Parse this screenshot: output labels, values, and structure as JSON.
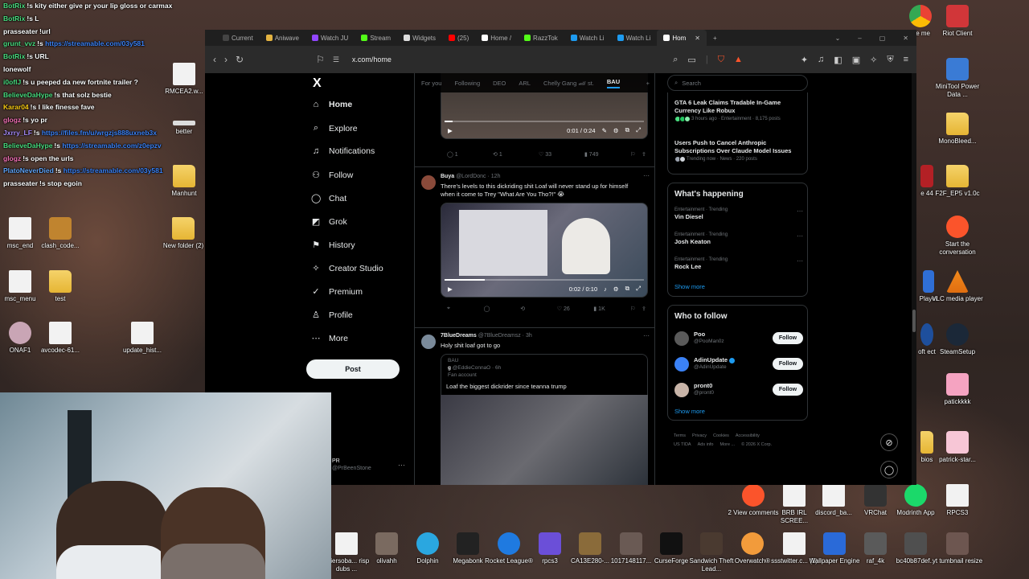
{
  "chat": [
    {
      "user": "BotRix",
      "color": "#4ade80",
      "msg": "!s kity either give pr your lip gloss or carmax",
      "link": ""
    },
    {
      "user": "BotRix",
      "color": "#4ade80",
      "msg": "!s L",
      "link": ""
    },
    {
      "user": "prasseater",
      "color": "#ffffff",
      "msg": "!url",
      "link": ""
    },
    {
      "user": "grunt_vvz",
      "color": "#4ade80",
      "msg": "!s",
      "link": "https://streamable.com/03y581"
    },
    {
      "user": "BotRix",
      "color": "#4ade80",
      "msg": "!s URL",
      "link": ""
    },
    {
      "user": "lonewolf",
      "color": "#ffffff",
      "msg": "",
      "link": ""
    },
    {
      "user": "i0oflJ",
      "color": "#4ade80",
      "msg": "!s u peeped da new fortnite trailer ?",
      "link": ""
    },
    {
      "user": "BelieveDaHype",
      "color": "#4ade80",
      "msg": "!s that solz bestie",
      "link": ""
    },
    {
      "user": "Karar04",
      "color": "#facc15",
      "msg": "!s I like finesse fave",
      "link": ""
    },
    {
      "user": "glogz",
      "color": "#f472b6",
      "msg": "!s yo pr",
      "link": ""
    },
    {
      "user": "Jxrry_LF",
      "color": "#a78bfa",
      "msg": "!s",
      "link": "https://files.fm/u/wrgzjs888uxneb3x"
    },
    {
      "user": "BelieveDaHype",
      "color": "#4ade80",
      "msg": "!s",
      "link": "https://streamable.com/z0epzv"
    },
    {
      "user": "glogz",
      "color": "#f472b6",
      "msg": "!s open the urls",
      "link": ""
    },
    {
      "user": "PlatoNeverDied",
      "color": "#60a5fa",
      "msg": "!s",
      "link": "https://streamable.com/03y581"
    },
    {
      "user": "prasseater",
      "color": "#ffffff",
      "msg": "!s stop egoin",
      "link": ""
    }
  ],
  "desktop_left": [
    {
      "label": "RMCEA2.w...",
      "kind": "file"
    },
    {
      "label": "better",
      "kind": "file"
    },
    {
      "label": "Manhunt",
      "kind": "folder"
    },
    {
      "label": "msc_end",
      "kind": "app"
    },
    {
      "label": "clash_code...",
      "kind": "app"
    },
    {
      "label": "New folder (2)",
      "kind": "folder"
    },
    {
      "label": "msc_menu",
      "kind": "app"
    },
    {
      "label": "test",
      "kind": "folder"
    },
    {
      "label": "ONAF1",
      "kind": "app"
    },
    {
      "label": "avcodec-61...",
      "kind": "file"
    },
    {
      "label": "update_hist...",
      "kind": "file"
    }
  ],
  "desktop_right": [
    {
      "label": "gle me",
      "kind": "app"
    },
    {
      "label": "Riot Client",
      "kind": "app"
    },
    {
      "label": "MiniTool Power Data ...",
      "kind": "app"
    },
    {
      "label": "MonoBleed...",
      "kind": "folder"
    },
    {
      "label": "e 44",
      "kind": "app"
    },
    {
      "label": "F2F_EP5 v1.0c",
      "kind": "folder"
    },
    {
      "label": "Start the conversation",
      "kind": "app"
    },
    {
      "label": "Player",
      "kind": "app"
    },
    {
      "label": "VLC media player",
      "kind": "app"
    },
    {
      "label": "oft ect",
      "kind": "app"
    },
    {
      "label": "SteamSetup",
      "kind": "app"
    },
    {
      "label": "patickkkk",
      "kind": "app"
    },
    {
      "label": "bios",
      "kind": "folder"
    },
    {
      "label": "patrick-star...",
      "kind": "app"
    }
  ],
  "desktop_bottom": [
    {
      "label": "aviersoba... risp dubs ...",
      "kind": "app"
    },
    {
      "label": "olivahh",
      "kind": "app"
    },
    {
      "label": "Dolphin",
      "kind": "app"
    },
    {
      "label": "Megabonk",
      "kind": "app"
    },
    {
      "label": "Rocket League®",
      "kind": "app"
    },
    {
      "label": "rpcs3",
      "kind": "app"
    },
    {
      "label": "CA13E280-...",
      "kind": "app"
    },
    {
      "label": "1017148117...",
      "kind": "app"
    },
    {
      "label": "CurseForge",
      "kind": "app"
    },
    {
      "label": "Sandwich Theft Lead...",
      "kind": "app"
    },
    {
      "label": "Overwatch®",
      "kind": "app"
    },
    {
      "label": "ssstwitter.c... (1)",
      "kind": "file"
    },
    {
      "label": "Wallpaper Engine",
      "kind": "app"
    },
    {
      "label": "raf_4k",
      "kind": "app"
    },
    {
      "label": "bc40b87def...",
      "kind": "app"
    },
    {
      "label": "yt tumbnail resize",
      "kind": "app"
    }
  ],
  "desktop_lower_right": [
    {
      "label": "2 View comments",
      "kind": "app"
    },
    {
      "label": "BRB IRL SCREE...",
      "kind": "file"
    },
    {
      "label": "discord_ba...",
      "kind": "file"
    },
    {
      "label": "VRChat",
      "kind": "app"
    },
    {
      "label": "Modrinth App",
      "kind": "app"
    },
    {
      "label": "RPCS3",
      "kind": "file"
    }
  ],
  "browser": {
    "tabs": [
      {
        "label": "Current",
        "active": false
      },
      {
        "label": "Aniwave",
        "active": false
      },
      {
        "label": "Watch JU",
        "active": false
      },
      {
        "label": "Stream",
        "active": false
      },
      {
        "label": "Widgets",
        "active": false
      },
      {
        "label": "(25)",
        "active": false
      },
      {
        "label": "Home /",
        "active": false
      },
      {
        "label": "RazzTok",
        "active": false
      },
      {
        "label": "Watch Li",
        "active": false
      },
      {
        "label": "Watch Li",
        "active": false
      },
      {
        "label": "Hom",
        "active": true
      }
    ],
    "new_tab": "+",
    "url": "x.com/home"
  },
  "x": {
    "logo": "X",
    "nav": [
      {
        "icon": "⌂",
        "label": "Home",
        "active": true
      },
      {
        "icon": "⌕",
        "label": "Explore",
        "active": false
      },
      {
        "icon": "♫",
        "label": "Notifications",
        "active": false
      },
      {
        "icon": "⚇",
        "label": "Follow",
        "active": false
      },
      {
        "icon": "◯",
        "label": "Chat",
        "active": false
      },
      {
        "icon": "◩",
        "label": "Grok",
        "active": false
      },
      {
        "icon": "⚑",
        "label": "History",
        "active": false
      },
      {
        "icon": "✧",
        "label": "Creator Studio",
        "active": false
      },
      {
        "icon": "✓",
        "label": "Premium",
        "active": false
      },
      {
        "icon": "♙",
        "label": "Profile",
        "active": false
      },
      {
        "icon": "⋯",
        "label": "More",
        "active": false
      }
    ],
    "post_button": "Post",
    "account": {
      "name": "PR",
      "handle": "@PrBeenStone",
      "more": "···"
    },
    "feed_tabs": [
      "For you",
      "Following",
      "DEO",
      "ARL",
      "Chelly Gang 🏎 st.",
      "BAU"
    ],
    "feed_active_tab": "BAU",
    "feed_plus": "+",
    "top_video": {
      "time": "0:01 / 0:24",
      "progress": 0.04
    },
    "top_actions": {
      "replies": "1",
      "reposts": "1",
      "likes": "33",
      "views": "749"
    },
    "tweet1": {
      "name": "Buya",
      "handle": "@LordDonc",
      "time": "12h",
      "text": "There's levels to this dickriding shit Loaf will never stand up for himself when it come to Trey \"What Are You Tho?!\" 😭",
      "video_time": "0:02 / 0:10",
      "progress": 0.2,
      "actions": {
        "replies": "",
        "reposts": "",
        "likes": "26",
        "views": "1K"
      }
    },
    "tweet2": {
      "name": "7BlueDreams",
      "handle": "@7BlueDreamsz",
      "time": "3h",
      "text": "Holy shit loaf got to go",
      "quote": {
        "context": "BAU",
        "name": "g",
        "handle": "@EddieConnaO",
        "time": "6h",
        "badge": "Fan account",
        "text": "Loaf the biggest dickrider since teanna trump"
      }
    },
    "search_placeholder": "Search",
    "news": [
      {
        "title": "GTA 6 Leak Claims Tradable In-Game Currency Like Robux",
        "meta": "3 hours ago · Entertainment · 8,175 posts"
      },
      {
        "title": "Users Push to Cancel Anthropic Subscriptions Over Claude Model Issues",
        "meta": "Trending now · News · 220 posts"
      }
    ],
    "whats_happening_title": "What's happening",
    "trends": [
      {
        "meta": "Entertainment · Trending",
        "name": "Vin Diesel"
      },
      {
        "meta": "Entertainment · Trending",
        "name": "Josh Keaton"
      },
      {
        "meta": "Entertainment · Trending",
        "name": "Rock Lee"
      }
    ],
    "show_more": "Show more",
    "who_to_follow_title": "Who to follow",
    "who_to_follow": [
      {
        "name": "Poo",
        "handle": "@PooMan0z",
        "verified": false
      },
      {
        "name": "AdinUpdate",
        "handle": "@AdinUpdate",
        "verified": true
      },
      {
        "name": "pront0",
        "handle": "@pront0",
        "verified": false
      }
    ],
    "follow_label": "Follow",
    "footer": [
      "Terms",
      "Privacy",
      "Cookies",
      "Accessibility",
      "US TIDA",
      "Ads info",
      "More ...",
      "© 2026 X Corp."
    ]
  },
  "colors": {
    "accent": "#1d9bf0",
    "bg": "#000000",
    "brave": "#fb542b"
  }
}
